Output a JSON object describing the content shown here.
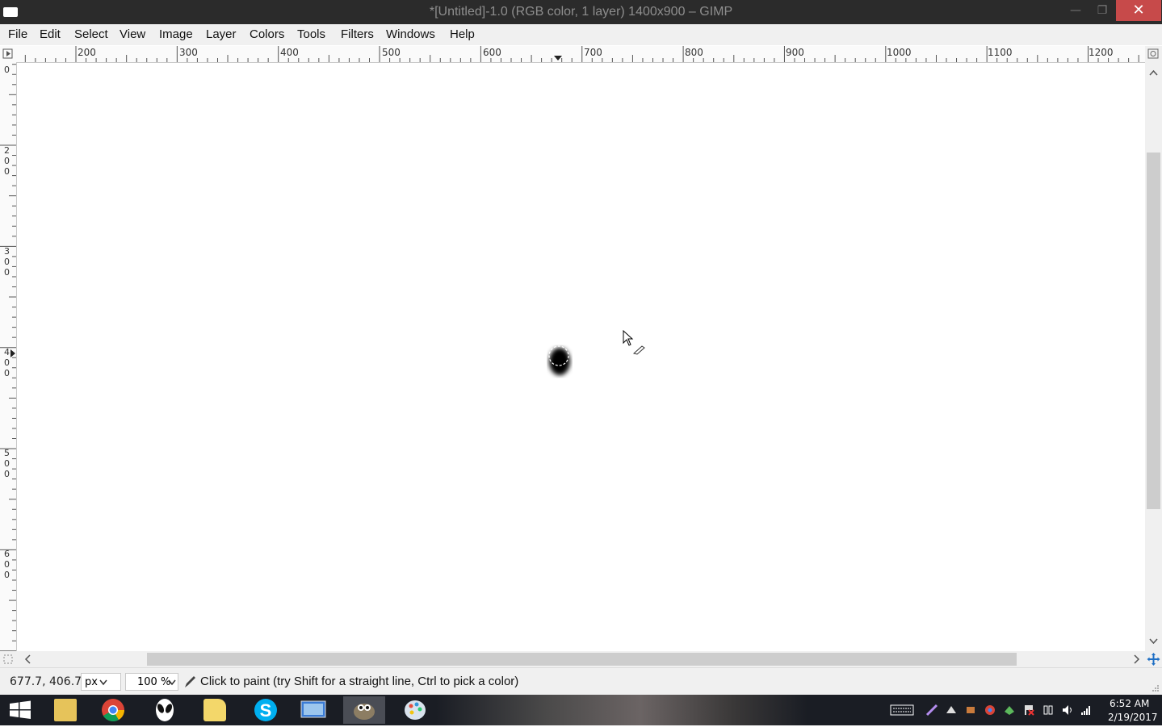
{
  "window": {
    "title": "*[Untitled]-1.0 (RGB color, 1 layer) 1400x900 – GIMP",
    "min_glyph": "—",
    "max_glyph": "❐",
    "close_glyph": "✕"
  },
  "menu": {
    "items": [
      "File",
      "Edit",
      "Select",
      "View",
      "Image",
      "Layer",
      "Colors",
      "Tools",
      "Filters",
      "Windows",
      "Help"
    ]
  },
  "rulers": {
    "horizontal_labels": [
      "200",
      "300",
      "400",
      "500",
      "600",
      "700",
      "800",
      "900",
      "1000",
      "1100",
      "1200"
    ],
    "vertical_labels": [
      "0",
      "200",
      "300",
      "400",
      "500",
      "600"
    ]
  },
  "statusbar": {
    "coordinates": "677.7, 406.7",
    "unit": "px",
    "zoom": "100 %",
    "message": "Click to paint (try Shift for a straight line, Ctrl to pick a color)"
  },
  "taskbar": {
    "time": "6:52 AM",
    "date": "2/19/2017",
    "apps": [
      "start-icon",
      "file-explorer-icon",
      "chrome-icon",
      "alien-app-icon",
      "folder-icon",
      "skype-icon",
      "remote-desktop-icon",
      "gimp-icon",
      "paint-icon"
    ]
  },
  "colors": {
    "titlebar": "#2b2b2b",
    "close_button": "#c74a4a",
    "chrome": "#f0f0f0",
    "taskbar": "#1a1d24",
    "brush_stroke": "#000000"
  }
}
